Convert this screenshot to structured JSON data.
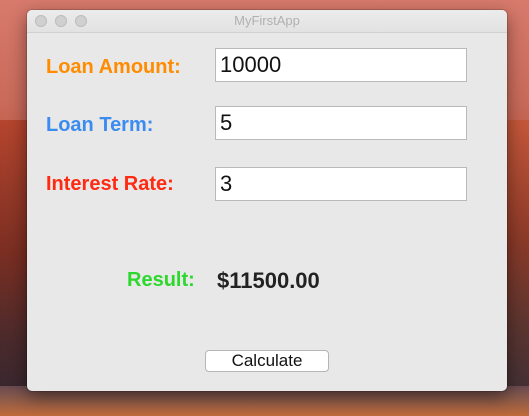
{
  "window": {
    "title": "MyFirstApp"
  },
  "form": {
    "loan_amount": {
      "label": "Loan Amount:",
      "value": "10000",
      "color": "#ff8c00"
    },
    "loan_term": {
      "label": "Loan Term:",
      "value": "5",
      "color": "#3b8cf0"
    },
    "interest_rate": {
      "label": "Interest Rate:",
      "value": "3",
      "color": "#ff2a12"
    }
  },
  "result": {
    "label": "Result:",
    "value": "$11500.00",
    "color": "#2dd82d"
  },
  "buttons": {
    "calculate_label": "Calculate"
  },
  "icons": {
    "close": "window-close-icon",
    "minimize": "window-minimize-icon",
    "maximize": "window-maximize-icon"
  }
}
